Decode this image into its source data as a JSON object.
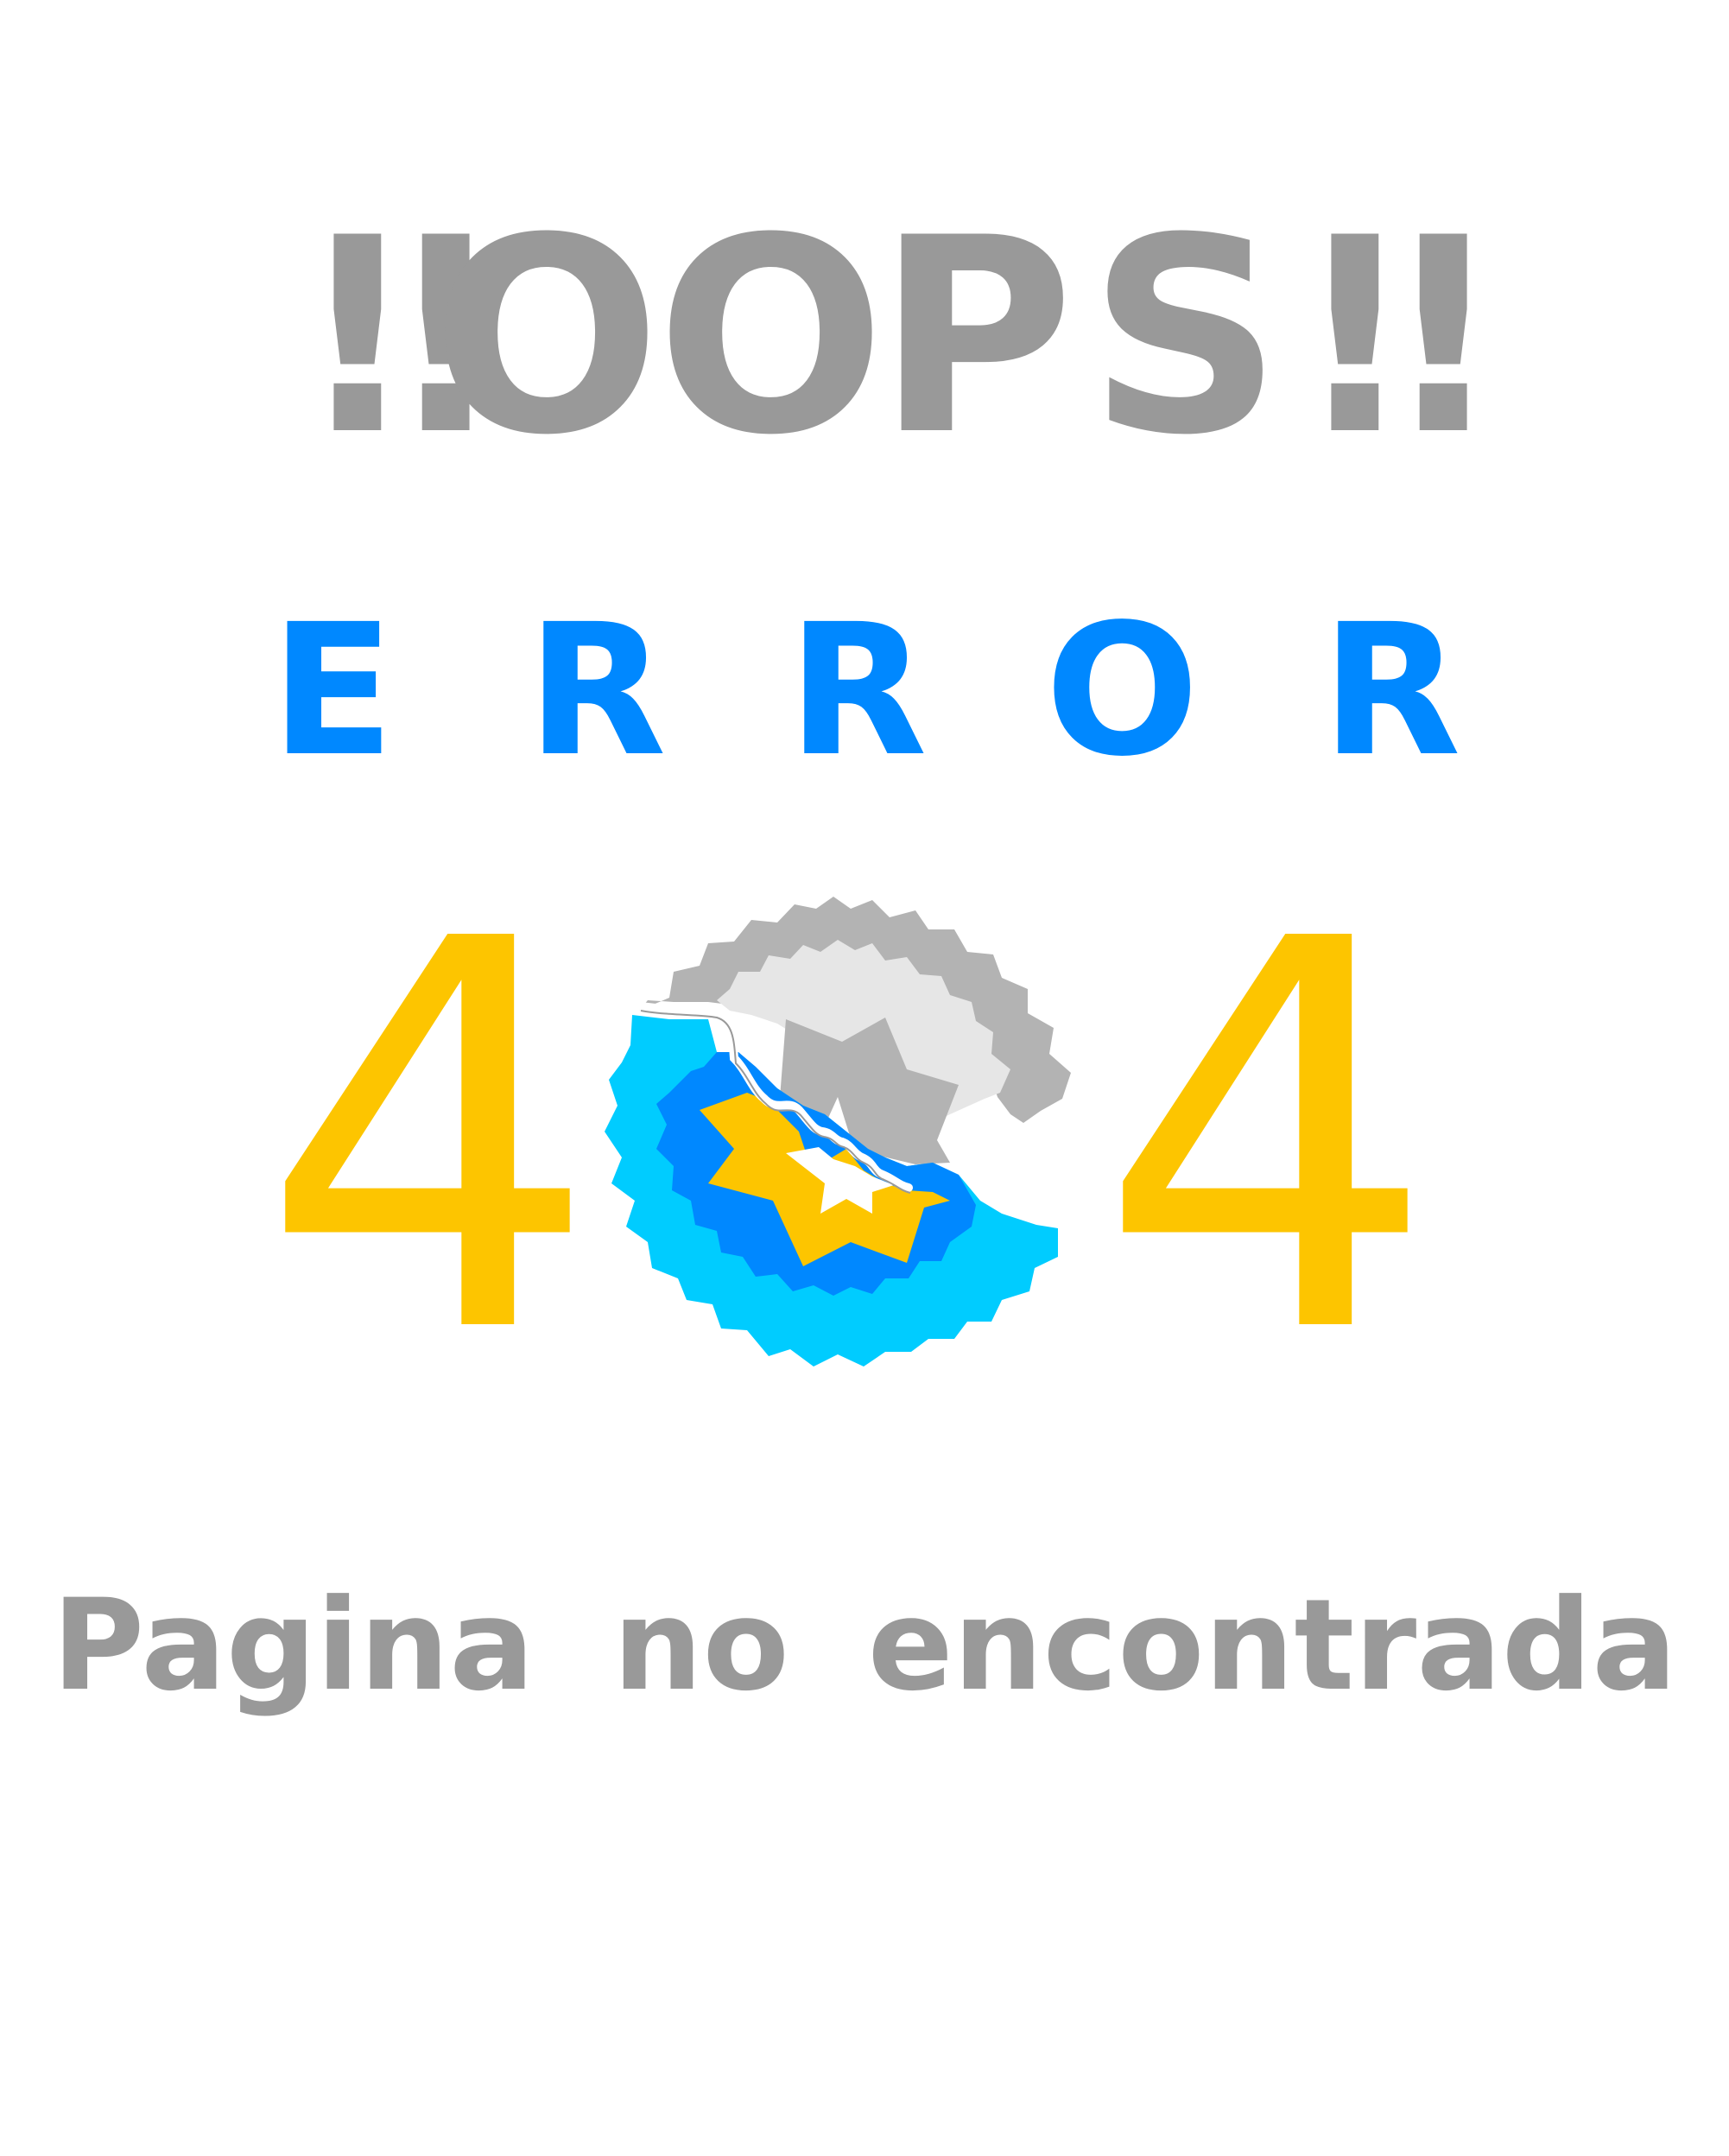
{
  "headline": {
    "chars": [
      "!!",
      "O",
      "O",
      "P",
      "S",
      "!!"
    ],
    "color": "#999999"
  },
  "error_word": {
    "chars": [
      "E",
      "R",
      "R",
      "O",
      "R"
    ],
    "color": "#0088ff"
  },
  "code": {
    "left_digit": "4",
    "right_digit": "4",
    "color": "#fdc500"
  },
  "emblem": {
    "icon": "broken-star-badge-icon",
    "colors": {
      "outer_gray": "#b3b3b3",
      "inner_gray": "#e6e6e6",
      "cyan": "#00ccff",
      "blue": "#0088ff",
      "yellow": "#fdc500",
      "white": "#ffffff"
    }
  },
  "subtitle": "Pagina no encontrada"
}
